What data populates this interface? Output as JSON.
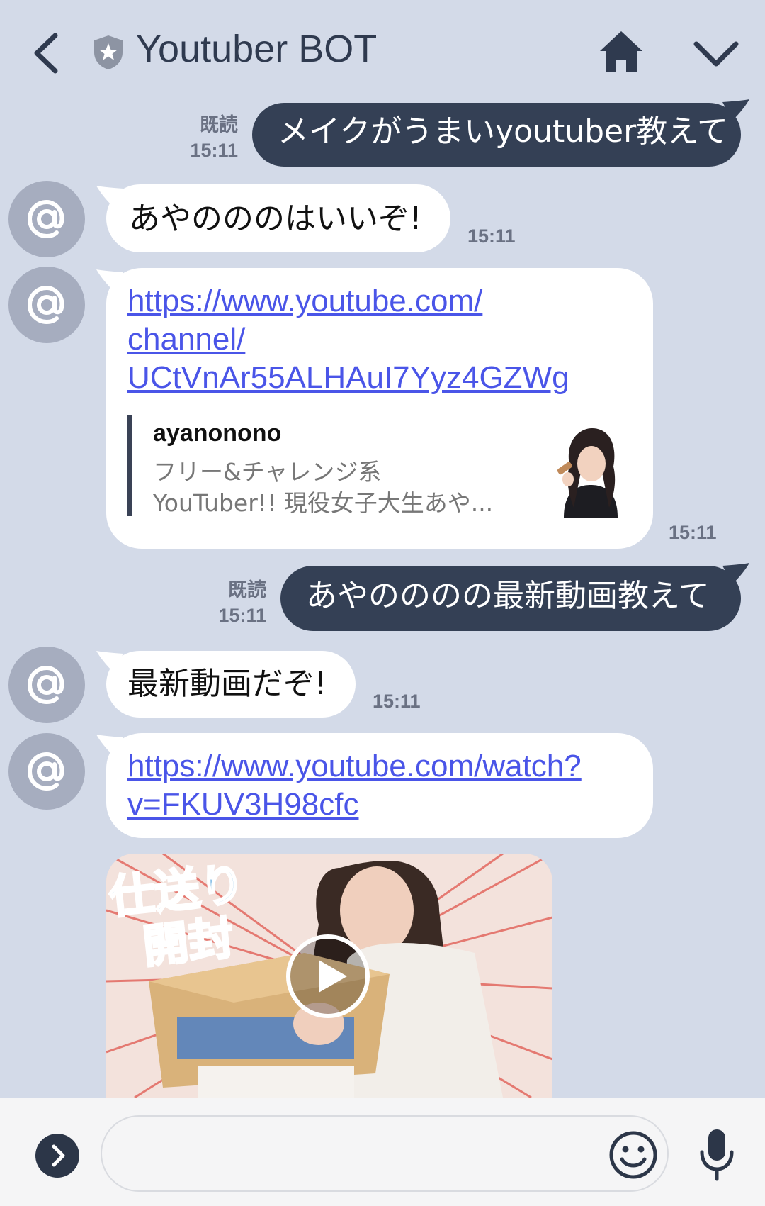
{
  "header": {
    "title": "Youtuber BOT",
    "icons": [
      "back-icon",
      "shield-star-icon",
      "home-icon",
      "chevron-down-icon"
    ]
  },
  "messages": [
    {
      "side": "out",
      "text": "メイクがうまいyoutuber教えて",
      "read": "既読",
      "time": "15:11"
    },
    {
      "side": "in",
      "text": "あやのののはいいぞ!",
      "time": "15:11"
    },
    {
      "side": "in",
      "type": "link",
      "lines": [
        "https://www.youtube.com/",
        "channel/",
        "UCtVnAr55ALHAuI7Yyz4GZWg"
      ],
      "time": "15:11",
      "preview": {
        "name": "ayanonono",
        "desc_line1": "フリー&チャレンジ系",
        "desc_line2": "YouTuber!! 現役女子大生あや..."
      }
    },
    {
      "side": "out",
      "text": "あやのののの最新動画教えて",
      "read": "既読",
      "time": "15:11"
    },
    {
      "side": "in",
      "text": "最新動画だぞ!",
      "time": "15:11"
    },
    {
      "side": "in",
      "type": "link",
      "lines": [
        "https://www.youtube.com/watch?",
        "v=FKUV3H98cfc"
      ]
    },
    {
      "side": "in",
      "type": "video",
      "overlay": "仕送り開封",
      "overlay_l1": "仕送り",
      "overlay_l2": "開封"
    }
  ],
  "input": {
    "placeholder": ""
  },
  "colors": {
    "background": "#d3dae8",
    "outgoing": "#344055",
    "incoming": "#ffffff",
    "link": "#4a55e8",
    "avatar": "#a6adbf"
  }
}
